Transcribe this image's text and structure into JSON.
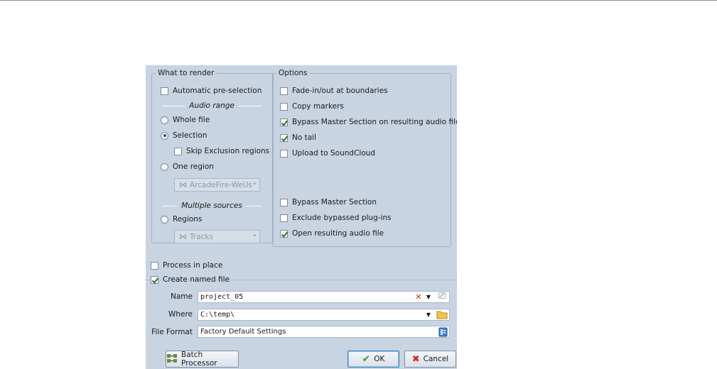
{
  "what_to_render": {
    "title": "What to render",
    "automatic_preselection": {
      "label": "Automatic pre-selection",
      "checked": false
    },
    "audio_range_label": "Audio range",
    "whole_file": {
      "label": "Whole file",
      "selected": false
    },
    "selection": {
      "label": "Selection",
      "selected": true
    },
    "skip_exclusion": {
      "label": "Skip Exclusion regions",
      "checked": false
    },
    "one_region": {
      "label": "One region",
      "selected": false
    },
    "region_combo_value": "ArcadeFire-WeUs",
    "multiple_sources_label": "Multiple sources",
    "regions": {
      "label": "Regions",
      "selected": false
    },
    "regions_combo_value": "Tracks"
  },
  "options": {
    "title": "Options",
    "items": [
      {
        "label": "Fade-in/out at boundaries",
        "checked": false
      },
      {
        "label": "Copy markers",
        "checked": false
      },
      {
        "label": "Bypass Master Section on resulting audio file",
        "checked": true
      },
      {
        "label": "No tail",
        "checked": true
      },
      {
        "label": "Upload to SoundCloud",
        "checked": false
      },
      {
        "label": "Bypass Master Section",
        "checked": false
      },
      {
        "label": "Exclude bypassed plug-ins",
        "checked": false
      },
      {
        "label": "Open resulting audio file",
        "checked": true
      }
    ]
  },
  "process_in_place": {
    "label": "Process in place",
    "checked": false
  },
  "create_named_file": {
    "label": "Create named file",
    "checked": true
  },
  "name_field": {
    "label": "Name",
    "value": "project_05"
  },
  "where_field": {
    "label": "Where",
    "value": "C:\\temp\\"
  },
  "format_field": {
    "label": "File Format",
    "value": "Factory Default Settings"
  },
  "buttons": {
    "batch": "Batch Processor",
    "ok": "OK",
    "cancel": "Cancel"
  },
  "colors": {
    "dialog_bg": "#c8d4e2",
    "check_green": "#3b6e1e",
    "cancel_red": "#d6281e",
    "ok_green": "#3f9a2b"
  }
}
